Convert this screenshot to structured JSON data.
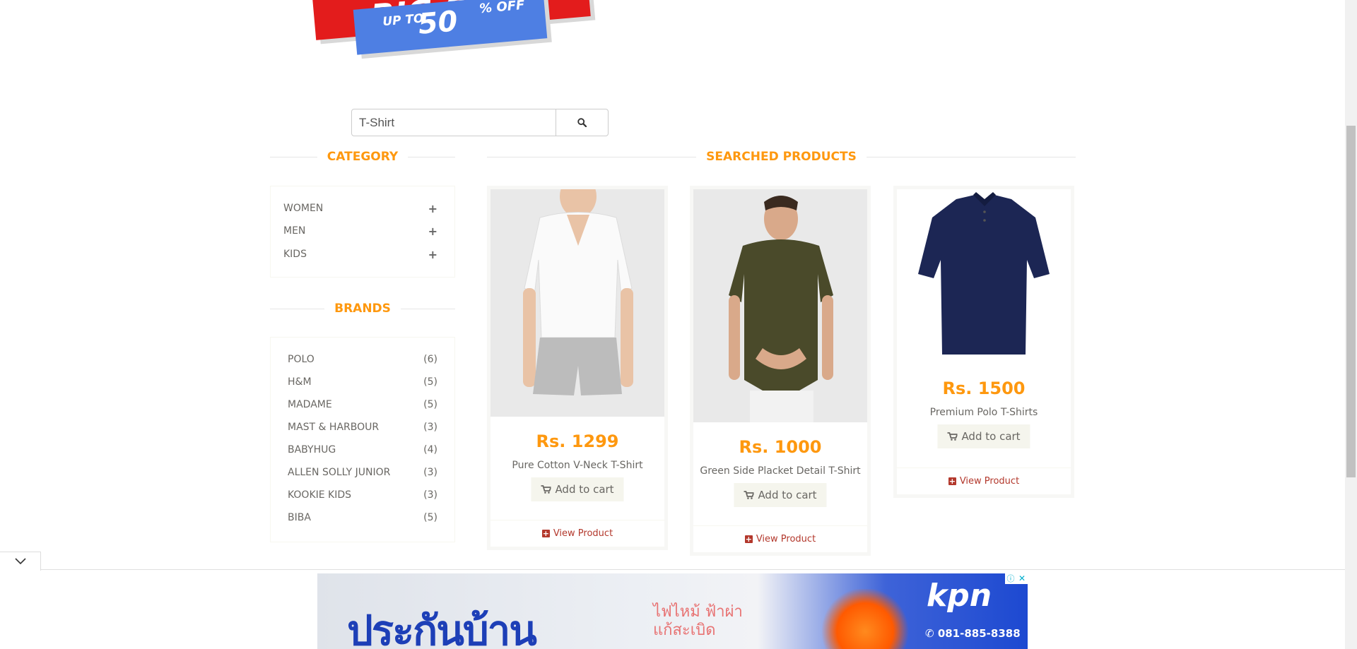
{
  "banner": {
    "big_text": "BIG SALE",
    "up_to": "UP TO",
    "discount": "50",
    "percent_off": "% OFF"
  },
  "search": {
    "value": "T-Shirt",
    "button_icon": "search-icon"
  },
  "category": {
    "title": "CATEGORY",
    "items": [
      {
        "label": "WOMEN",
        "icon": "plus-icon"
      },
      {
        "label": "MEN",
        "icon": "plus-icon"
      },
      {
        "label": "KIDS",
        "icon": "plus-icon"
      }
    ]
  },
  "brands": {
    "title": "BRANDS",
    "items": [
      {
        "label": "POLO",
        "count": "(6)"
      },
      {
        "label": "H&M",
        "count": "(5)"
      },
      {
        "label": "MADAME",
        "count": "(5)"
      },
      {
        "label": "MAST & HARBOUR",
        "count": "(3)"
      },
      {
        "label": "BABYHUG",
        "count": "(4)"
      },
      {
        "label": "ALLEN SOLLY JUNIOR",
        "count": "(3)"
      },
      {
        "label": "KOOKIE KIDS",
        "count": "(3)"
      },
      {
        "label": "BIBA",
        "count": "(5)"
      }
    ]
  },
  "products": {
    "title": "SEARCHED PRODUCTS",
    "items": [
      {
        "price": "Rs. 1299",
        "name": "Pure Cotton V-Neck T-Shirt",
        "cart_label": "Add to cart",
        "view_label": "View Product"
      },
      {
        "price": "Rs. 1000",
        "name": "Green Side Placket Detail T-Shirt",
        "cart_label": "Add to cart",
        "view_label": "View Product"
      },
      {
        "price": "Rs. 1500",
        "name": "Premium Polo T-Shirts",
        "cart_label": "Add to cart",
        "view_label": "View Product"
      }
    ]
  },
  "ad": {
    "thai_headline": "ประกันบ้าน",
    "thai_sub_1": "ไฟไหม้ ฟ้าผ่า",
    "thai_sub_2": "แก้สะเบิด",
    "logo": "kpn",
    "phone": "081-885-8388"
  },
  "colors": {
    "accent": "#fe980f",
    "link": "#b3382c",
    "sale_red": "#e31c1c",
    "sale_blue": "#4e7fe3"
  }
}
